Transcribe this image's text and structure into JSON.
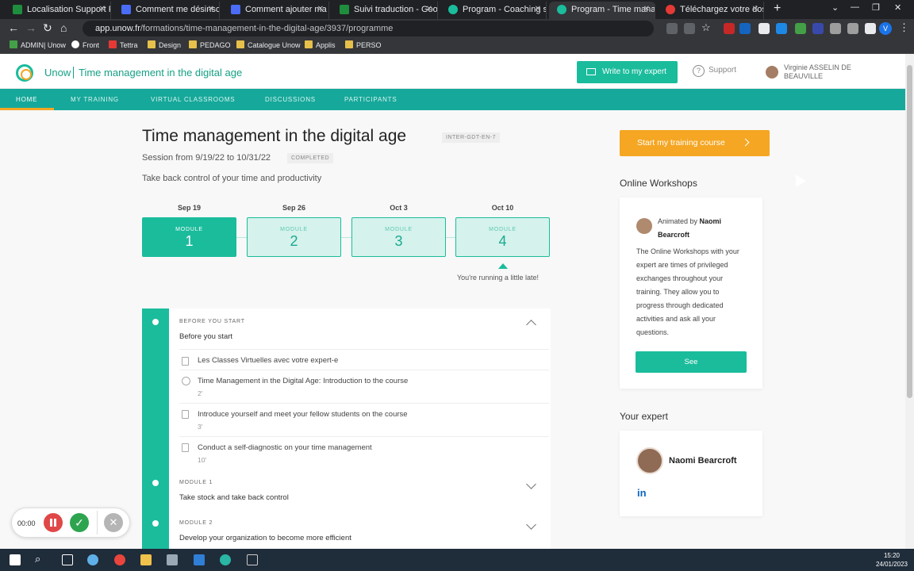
{
  "browser": {
    "tabs": [
      {
        "label": "Localisation Support Parti",
        "fav_color": "#1e8e3e"
      },
      {
        "label": "Comment me désinscrire",
        "fav_color": "#4a6cf7"
      },
      {
        "label": "Comment ajouter ma pho",
        "fav_color": "#4a6cf7"
      },
      {
        "label": "Suivi traduction - Google",
        "fav_color": "#1e8e3e"
      },
      {
        "label": "Program - Coaching skill",
        "fav_color": "#1abc9c"
      },
      {
        "label": "Program - Time managem",
        "fav_color": "#1abc9c"
      },
      {
        "label": "Téléchargez votre dossier",
        "fav_color": "#e53935"
      }
    ],
    "url_host": "app.unow.fr",
    "url_path": "/formations/time-management-in-the-digital-age/3937/programme",
    "profile_initial": "V",
    "bookmarks": [
      "ADMIN| Unow",
      "Front",
      "Tettra",
      "Design",
      "PEDAGO",
      "Catalogue Unow",
      "Applis",
      "PERSO"
    ]
  },
  "header": {
    "brand": "Unow",
    "course_title": "Time management in the digital age",
    "write_button": "Write to my expert",
    "support": "Support",
    "user_name": "Virginie ASSELIN DE BEAUVILLE"
  },
  "nav": [
    "HOME",
    "MY TRAINING",
    "VIRTUAL CLASSROOMS",
    "DISCUSSIONS",
    "PARTICIPANTS"
  ],
  "main": {
    "title": "Time management in the digital age",
    "code": "INTER-GDT-EN-7",
    "session": "Session from 9/19/22 to 10/31/22",
    "status": "COMPLETED",
    "subtitle": "Take back control of your time and productivity",
    "module_label": "MODULE",
    "modules": [
      {
        "date": "Sep 19",
        "number": "1"
      },
      {
        "date": "Sep 26",
        "number": "2"
      },
      {
        "date": "Oct 3",
        "number": "3"
      },
      {
        "date": "Oct 10",
        "number": "4"
      }
    ],
    "late_message": "You're running a little late!",
    "sections": [
      {
        "label": "BEFORE YOU START",
        "title": "Before you start"
      },
      {
        "label": "MODULE 1",
        "title": "Take stock and take back control"
      },
      {
        "label": "MODULE 2",
        "title": "Develop your organization to become more efficient"
      }
    ],
    "items": [
      {
        "title": "Les Classes Virtuelles avec votre expert-e",
        "duration": ""
      },
      {
        "title": "Time Management in the Digital Age: Introduction to the course",
        "duration": "2'"
      },
      {
        "title": "Introduce yourself and meet your fellow students on the course",
        "duration": "3'"
      },
      {
        "title": "Conduct a self-diagnostic on your time management",
        "duration": "10'"
      }
    ]
  },
  "sidebar": {
    "start_button": "Start my training course",
    "workshops_heading": "Online Workshops",
    "animated_by": "Animated by",
    "animator": "Naomi Bearcroft",
    "workshops_text": "The Online Workshops with your expert are times of privileged exchanges throughout your training. They allow you to progress through dedicated activities and ask all your questions.",
    "see_button": "See",
    "expert_heading": "Your expert",
    "expert_name": "Naomi Bearcroft",
    "linkedin": "in"
  },
  "recorder": {
    "time": "00:00"
  },
  "taskbar": {
    "time": "15:20",
    "date": "24/01/2023"
  },
  "colors": {
    "accent": "#1abc9c",
    "nav": "#16a89a",
    "orange": "#f5a623"
  }
}
